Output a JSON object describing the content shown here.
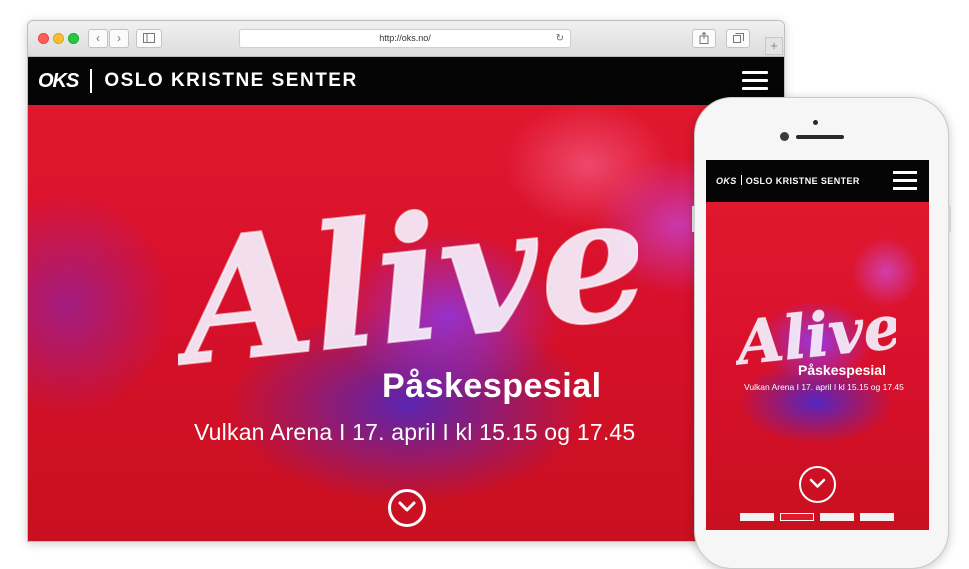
{
  "browser": {
    "url": "http://oks.no/",
    "nav": {
      "back": "‹",
      "forward": "›"
    },
    "add_tab": "+"
  },
  "site": {
    "logo_mark": "OKS",
    "logo_name": "OSLO KRISTNE SENTER",
    "hero": {
      "headline": "Alive!",
      "subtitle": "Påskespesial",
      "details": "Vulkan Arena I 17. april I kl 15.15 og 17.45"
    }
  },
  "phone": {
    "logo_mark": "OKS",
    "logo_name": "OSLO KRISTNE SENTER",
    "headline": "Alive!",
    "subtitle": "Påskespesial",
    "details": "Vulkan Arena I 17. april I kl 15.15 og 17.45",
    "slides": [
      {
        "active": false
      },
      {
        "active": true
      },
      {
        "active": false
      },
      {
        "active": false
      }
    ]
  },
  "colors": {
    "brand_black": "#050505",
    "hero_red": "#d8102c",
    "hero_purple": "#7a3cff"
  },
  "icons": {
    "menu": "hamburger-icon",
    "scroll": "chevron-down-circle-icon",
    "share": "share-icon",
    "tabs": "tabs-icon",
    "sidebar": "sidebar-icon",
    "reload": "reload-icon"
  }
}
